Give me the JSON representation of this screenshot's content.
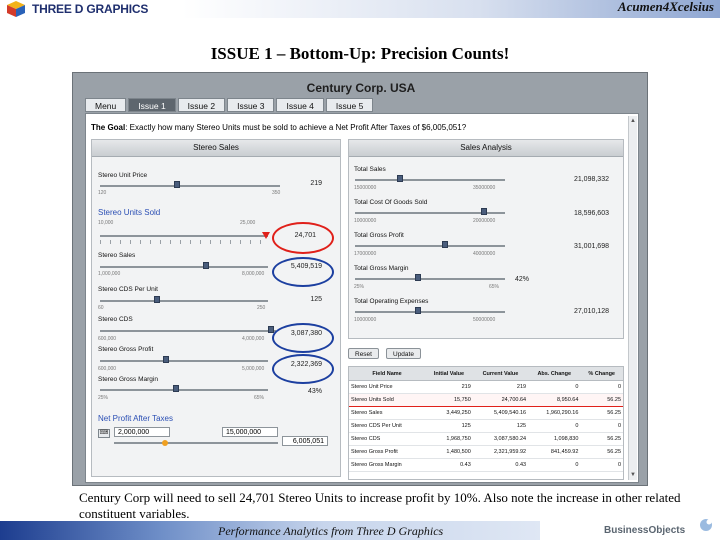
{
  "header": {
    "logo_text": "THREE D GRAPHICS",
    "brand_text": "Acumen4Xcelsius"
  },
  "slide_title": "ISSUE 1 – Bottom-Up: Precision Counts!",
  "dashboard": {
    "title": "Century Corp. USA",
    "tabs": [
      {
        "label": "Menu",
        "active": false
      },
      {
        "label": "Issue 1",
        "active": true
      },
      {
        "label": "Issue 2",
        "active": false
      },
      {
        "label": "Issue 3",
        "active": false
      },
      {
        "label": "Issue 4",
        "active": false
      },
      {
        "label": "Issue 5",
        "active": false
      }
    ],
    "goal_label": "The Goal",
    "goal_text": ": Exactly how many Stereo Units must be sold to achieve a Net Profit After Taxes of $6,005,051?",
    "stereo_sales": {
      "header": "Stereo Sales",
      "unit_price": {
        "label": "Stereo Unit Price",
        "value": "219",
        "min": "120",
        "max": "350",
        "level": 0.43
      },
      "units_sold": {
        "label": "Stereo Units Sold",
        "value": "24,701",
        "min": "10,000",
        "max": "25,000",
        "level": 0.98
      },
      "sales": {
        "label": "Stereo Sales",
        "value": "5,409,519",
        "min": "1,000,000",
        "max": "8,000,000",
        "level": 0.63
      },
      "cds_per_unit": {
        "label": "Stereo CDS Per Unit",
        "value": "125",
        "min": "60",
        "max": "250",
        "level": 0.34
      },
      "cds": {
        "label": "Stereo CDS",
        "value": "3,087,380",
        "min": "600,000",
        "max": "4,000,000",
        "level": 0.97
      },
      "gross_profit": {
        "label": "Stereo Gross Profit",
        "value": "2,322,369",
        "min": "600,000",
        "max": "5,000,000",
        "level": 0.39
      },
      "gross_margin": {
        "label": "Stereo Gross Margin",
        "value": "43%",
        "min": "25%",
        "max": "65%",
        "level": 0.45
      },
      "net_profit_label": "Net Profit After Taxes",
      "net_profit_min": "2,000,000",
      "net_profit_max": "15,000,000",
      "net_profit_value": "6,005,051",
      "net_profit_level": 0.31
    },
    "sales_analysis": {
      "header": "Sales Analysis",
      "total_sales": {
        "label": "Total Sales",
        "value": "21,098,332",
        "min": "15000000",
        "max": "35000000",
        "level": 0.3
      },
      "total_cogs": {
        "label": "Total Cost Of Goods Sold",
        "value": "18,596,603",
        "min": "10000000",
        "max": "20000000",
        "level": 0.86
      },
      "total_gross_profit": {
        "label": "Total Gross Profit",
        "value": "31,001,698",
        "min": "17000000",
        "max": "40000000",
        "level": 0.6
      },
      "total_gross_margin": {
        "label": "Total Gross Margin",
        "value": "42%",
        "min": "25%",
        "max": "65%",
        "level": 0.42
      },
      "total_operating_expenses": {
        "label": "Total Operating Expenses",
        "value": "27,010,128",
        "min": "10000000",
        "max": "50000000",
        "level": 0.42
      },
      "reset_label": "Reset",
      "update_label": "Update",
      "table": {
        "columns": [
          "Field Name",
          "Initial Value",
          "Current Value",
          "Abs. Change",
          "% Change"
        ],
        "rows": [
          {
            "name": "Stereo Unit Price",
            "initial": "219",
            "current": "219",
            "abs": "0",
            "pct": "0",
            "highlight": false
          },
          {
            "name": "Stereo Units Sold",
            "initial": "15,750",
            "current": "24,700.64",
            "abs": "8,950.64",
            "pct": "56.25",
            "highlight": true
          },
          {
            "name": "Stereo Sales",
            "initial": "3,449,250",
            "current": "5,409,540.16",
            "abs": "1,960,290.16",
            "pct": "56.25",
            "highlight": false
          },
          {
            "name": "Stereo CDS Per Unit",
            "initial": "125",
            "current": "125",
            "abs": "0",
            "pct": "0",
            "highlight": false
          },
          {
            "name": "Stereo CDS",
            "initial": "1,968,750",
            "current": "3,087,580.24",
            "abs": "1,098,830",
            "pct": "56.25",
            "highlight": false
          },
          {
            "name": "Stereo Gross Profit",
            "initial": "1,480,500",
            "current": "2,321,959.92",
            "abs": "841,459.92",
            "pct": "56.25",
            "highlight": false
          },
          {
            "name": "Stereo Gross Margin",
            "initial": "0.43",
            "current": "0.43",
            "abs": "0",
            "pct": "0",
            "highlight": false
          }
        ]
      }
    }
  },
  "caption": "Century Corp will need to sell 24,701 Stereo Units to increase profit by 10%. Also note the increase in other related constituent variables.",
  "footer": {
    "text": "Performance Analytics from Three D Graphics",
    "bo_logo_text": "BusinessObjects"
  },
  "colors": {
    "accent_blue": "#1c3fa0",
    "highlight_red": "#e0201a",
    "label_blue": "#2b4fb4"
  }
}
